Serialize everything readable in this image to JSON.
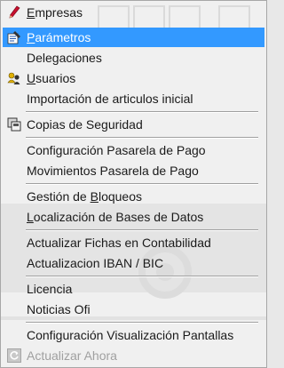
{
  "menu": {
    "empresas": {
      "pre": "",
      "key": "E",
      "post": "mpresas"
    },
    "parametros": {
      "pre": "",
      "key": "P",
      "post": "arámetros"
    },
    "delegaciones": "Delegaciones",
    "usuarios": {
      "pre": "",
      "key": "U",
      "post": "suarios"
    },
    "importacion": "Importación de articulos inicial",
    "copias": "Copias de Seguridad",
    "config_pasarela": "Configuración Pasarela de Pago",
    "movimientos_pasarela": "Movimientos Pasarela de Pago",
    "gestion_bloqueos": {
      "pre": "Gestión de ",
      "key": "B",
      "post": "loqueos"
    },
    "localizacion_bd": {
      "pre": "",
      "key": "L",
      "post": "ocalización de Bases de Datos"
    },
    "actualizar_fichas": "Actualizar Fichas en Contabilidad",
    "actualizacion_iban": "Actualizacion IBAN / BIC",
    "licencia": "Licencia",
    "noticias": "Noticias Ofi",
    "config_visualizacion": "Configuración Visualización Pantallas",
    "actualizar_ahora": "Actualizar Ahora"
  },
  "colors": {
    "highlight": "#3399ff",
    "disabled_text": "#a0a0a0"
  },
  "icons": {
    "empresas": "pencil-icon",
    "parametros": "parameters-icon",
    "usuarios": "users-icon",
    "copias": "backup-icon",
    "actualizar_ahora": "refresh-icon"
  }
}
